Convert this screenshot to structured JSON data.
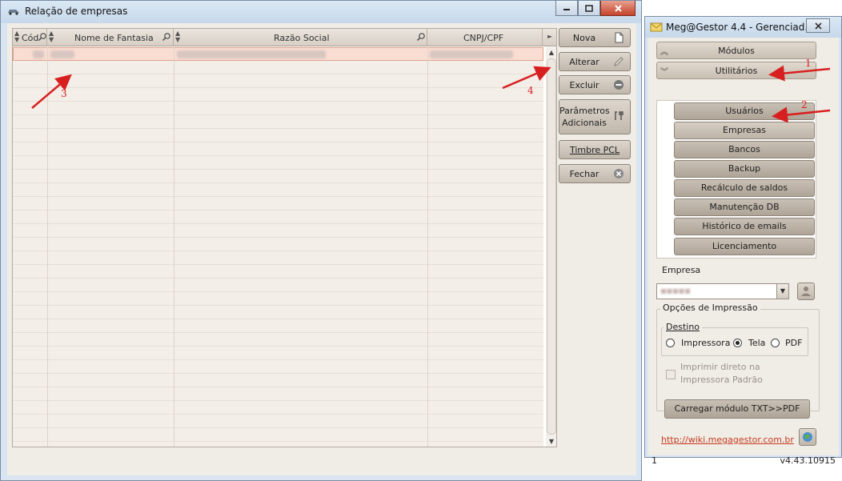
{
  "empresas_window": {
    "title": "Relação de empresas",
    "columns": [
      "Cód",
      "Nome de Fantasia",
      "Razão Social",
      "CNPJ/CPF"
    ],
    "buttons": {
      "nova": "Nova",
      "alterar": "Alterar",
      "excluir": "Excluir",
      "parametros_line1": "Parâmetros",
      "parametros_line2": "Adicionais",
      "timbre": "Timbre PCL",
      "fechar": "Fechar"
    }
  },
  "gestor_window": {
    "title": "Meg@Gestor 4.4 - Gerenciad...",
    "nav": {
      "modulos": "Módulos",
      "utilitarios": "Utilitários"
    },
    "utilitarios_items": [
      "Usuários",
      "Empresas",
      "Bancos",
      "Backup",
      "Recálculo de saldos",
      "Manutenção DB",
      "Histórico de emails",
      "Licenciamento"
    ],
    "empresa_label": "Empresa",
    "opcoes_impressao": "Opções de Impressão",
    "destino_label": "Destino",
    "destinos": [
      {
        "label": "Impressora",
        "selected": false
      },
      {
        "label": "Tela",
        "selected": true
      },
      {
        "label": "PDF",
        "selected": false
      }
    ],
    "imprimir_direto_line1": "Imprimir direto na",
    "imprimir_direto_line2": "Impressora Padrão",
    "carregar_button": "Carregar módulo TXT>>PDF",
    "link": "http://wiki.megagestor.com.br",
    "status_left": "1",
    "status_right": "v4.43.10915"
  },
  "annotations": [
    "1",
    "2",
    "3",
    "4"
  ],
  "colors": {
    "annotation": "#d81f1f",
    "selected_row": "#f9ddd2",
    "link": "#c43b1c"
  }
}
